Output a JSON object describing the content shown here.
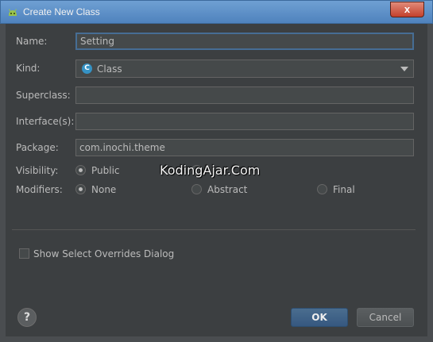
{
  "window": {
    "title": "Create New Class",
    "close_glyph": "x"
  },
  "form": {
    "name_label": "Name:",
    "name_value": "Setting",
    "kind_label": "Kind:",
    "kind_value": "Class",
    "kind_icon_letter": "C",
    "superclass_label": "Superclass:",
    "superclass_value": "",
    "interfaces_label": "Interface(s):",
    "interfaces_value": "",
    "package_label": "Package:",
    "package_value": "com.inochi.theme",
    "visibility_label": "Visibility:",
    "visibility_options": [
      {
        "label": "Public",
        "checked": true
      },
      {
        "label": "",
        "checked": false
      }
    ],
    "modifiers_label": "Modifiers:",
    "modifier_options": [
      {
        "label": "None",
        "checked": true
      },
      {
        "label": "Abstract",
        "checked": false
      },
      {
        "label": "Final",
        "checked": false
      }
    ],
    "show_overrides_label": "Show Select Overrides Dialog",
    "show_overrides_checked": false
  },
  "watermark": "KodingAjar.Com",
  "buttons": {
    "help": "?",
    "ok": "OK",
    "cancel": "Cancel"
  },
  "colors": {
    "accent_blue": "#3592c4",
    "ok_button": "#365880",
    "dialog_bg": "#3c3f41",
    "focus_border": "#466d94"
  }
}
